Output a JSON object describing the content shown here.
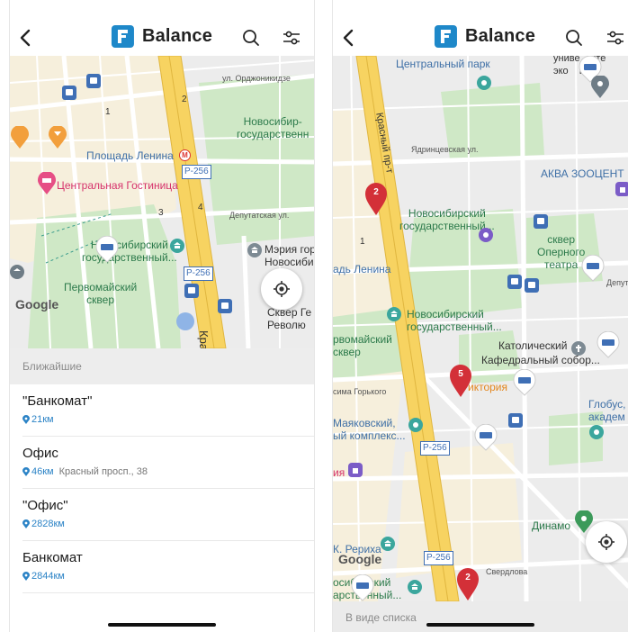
{
  "app": {
    "title": "Balance"
  },
  "left": {
    "map": {
      "labels": {
        "ordzhonikidze": "ул. Орджоникидзе",
        "novosib_univ_top": "Новосибир-\nгосударственн",
        "lenin_square": "Площадь Ленина",
        "central_hotel": "Центральная Гостиница",
        "deputatskaya": "Депутатская ул.",
        "univ_short": "Новосибирский\nгосударственный...",
        "pervomaisky": "Первомайский\nсквер",
        "meria": "Мэрия гор\nНовосиби",
        "skver": "Сквер Ге\nРеволю",
        "road_p256_a": "Р-256",
        "road_p256_b": "Р-256",
        "kra": "Кра",
        "google": "Google",
        "num_1": "1",
        "num_2": "2",
        "num_3": "3",
        "num_4": "4"
      }
    },
    "section_header": "Ближайшие",
    "items": [
      {
        "name": "\"Банкомат\"",
        "distance": "21км",
        "address": ""
      },
      {
        "name": "Офис",
        "distance": "46км",
        "address": "Красный просп., 38"
      },
      {
        "name": "\"Офис\"",
        "distance": "2828км",
        "address": ""
      },
      {
        "name": "Банкомат",
        "distance": "2844км",
        "address": ""
      }
    ]
  },
  "right": {
    "map": {
      "labels": {
        "central_park": "Центральный парк",
        "univ_top": "униве  сите\nэко    ики.",
        "krasny": "Красный пр-т",
        "yadrintsev": "Ядринцевская ул.",
        "akva": "АКВА ЗООЦЕНТ",
        "novosib_univ": "Новосибирский\nгосударственный...",
        "skver_opera": "сквер\nОперного\nтеатра",
        "lenin_short": "адь Ленина",
        "univ_second": "Новосибирский\nгосударственный...",
        "pervomaisky": "рвомайский\nсквер",
        "katolich": "Католический",
        "kafedral": "Кафедральный собор...",
        "gorkogo": "сима Горького",
        "victoria": "иктория",
        "globus": "Глобус,\nакадем",
        "mayakovsky": "Маяковский,\nый комплекс...",
        "ya": "ия",
        "dinamo": "Динамо",
        "rerikha": "К. Рериха",
        "road_p256_a": "Р-256",
        "road_p256_b": "Р-256",
        "sverdlova": "Свердлова",
        "univ_bottom": "осибирский\nарственный...",
        "google": "Google",
        "deput": "Депут",
        "num_1": "1"
      },
      "pins": {
        "a": "2",
        "b": "5",
        "c": "2"
      }
    },
    "bottom_bar": "В виде списка"
  },
  "colors": {
    "accent": "#2b83c6",
    "logo": "#1e88c9",
    "pin": "#d33038",
    "road": "#f7d361",
    "park": "#cfe8c6",
    "urban": "#f6efdc"
  }
}
